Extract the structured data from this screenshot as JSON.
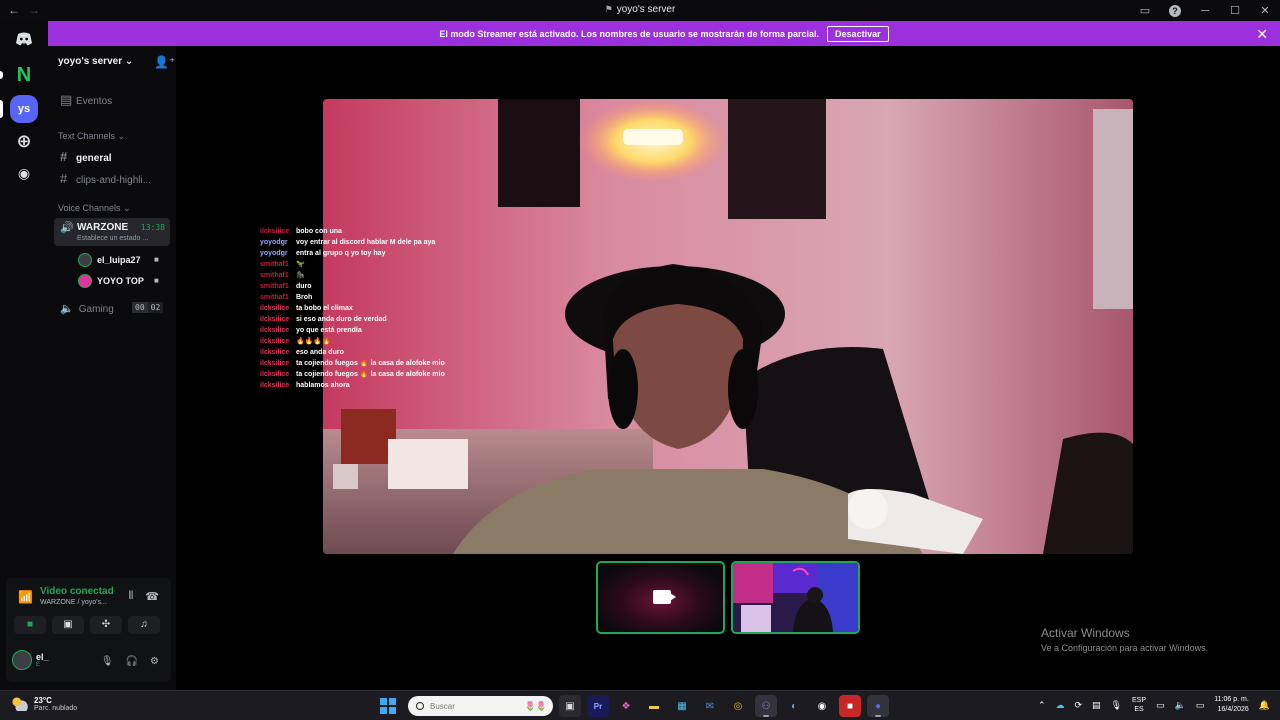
{
  "window": {
    "title": "yoyo's server",
    "nav_back": "←",
    "nav_forward": "→",
    "help": "?",
    "minimize": "─",
    "maximize": "☐",
    "close": "✕"
  },
  "banner": {
    "text": "El modo Streamer está activado. Los nombres de usuario se mostrarán de forma parcial.",
    "button": "Desactivar",
    "close": "✕"
  },
  "rail": {
    "server_abbr": "ys",
    "nb_label": "N"
  },
  "sidebar": {
    "server_name": "yoyo's server ⌄",
    "events": "Eventos",
    "text_category": "Text Channels ⌄",
    "channels": [
      {
        "name": "general"
      },
      {
        "name": "clips-and-highli..."
      }
    ],
    "voice_category": "Voice Channels ⌄",
    "active_voice": {
      "name": "WARZONE",
      "timer": "13:38",
      "status": "Establece un estado ..."
    },
    "members": [
      {
        "name": "el_luipa27"
      },
      {
        "name": "YOYO TOP"
      }
    ],
    "gaming": {
      "name": "Gaming",
      "count_a": "00",
      "count_b": "02"
    }
  },
  "voice_panel": {
    "title": "Video conectad",
    "subtitle": "WARZONE / yoyo's...",
    "user_name": "el_",
    "user_status": "E"
  },
  "chat": [
    {
      "user": "ilcksilice",
      "msg": "bobo con una",
      "color": "red"
    },
    {
      "user": "yoyodgr",
      "msg": "voy entrar al discord hablar M dele pa aya",
      "color": "blue"
    },
    {
      "user": "yoyodgr",
      "msg": "entra al grupo q yo toy hay",
      "color": "blue"
    },
    {
      "user": "smithaf1",
      "msg": "🦖",
      "color": "dark"
    },
    {
      "user": "smithaf1",
      "msg": "🦍",
      "color": "dark"
    },
    {
      "user": "smithaf1",
      "msg": "duro",
      "color": "dark"
    },
    {
      "user": "smithaf1",
      "msg": "Broh",
      "color": "dark"
    },
    {
      "user": "ilcksilice",
      "msg": "ta bobo el climax",
      "color": "red"
    },
    {
      "user": "ilcksilice",
      "msg": "si eso anda duro de verdad",
      "color": "red"
    },
    {
      "user": "ilcksilice",
      "msg": "yo que está prendía",
      "color": "red"
    },
    {
      "user": "ilcksilice",
      "msg": "🔥🔥🔥🔥",
      "color": "red"
    },
    {
      "user": "ilcksilice",
      "msg": "eso anda duro",
      "color": "red"
    },
    {
      "user": "ilcksilice",
      "msg": "ta cojiendo fuegos 🔥 la casa de alofoke mio",
      "color": "red"
    },
    {
      "user": "ilcksilice",
      "msg": "ta cojiendo fuegos 🔥 la casa de alofoke mio",
      "color": "red"
    },
    {
      "user": "ilcksilice",
      "msg": "hablamos ahora",
      "color": "red"
    }
  ],
  "watermark": {
    "line1": "Activar Windows",
    "line2": "Ve a Configuración para activar Windows."
  },
  "taskbar": {
    "temp": "23°C",
    "condition": "Parc. nublado",
    "search_placeholder": "Buscar",
    "lang1": "ESP",
    "lang2": "ES",
    "time": "11:06 p. m.",
    "date": "16/4/2026"
  }
}
